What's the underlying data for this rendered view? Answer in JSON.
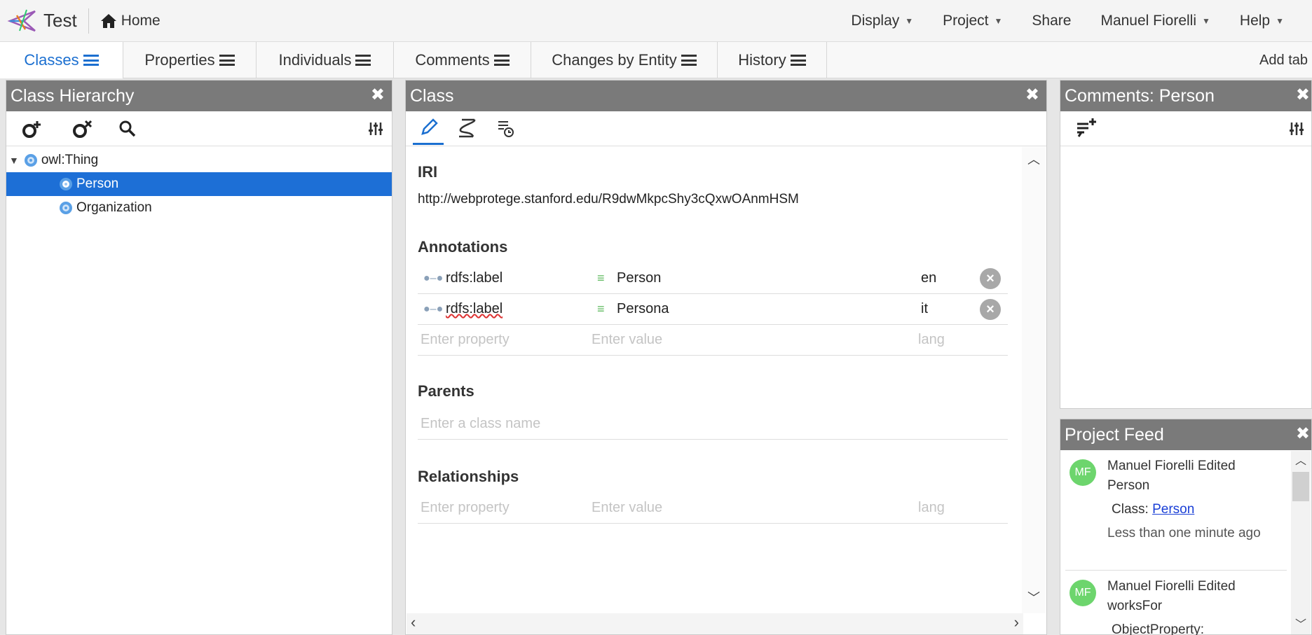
{
  "app": {
    "project_name": "Test",
    "home_label": "Home"
  },
  "topmenu": {
    "display": "Display",
    "project": "Project",
    "share": "Share",
    "user": "Manuel Fiorelli",
    "help": "Help"
  },
  "tabs": [
    {
      "label": "Classes",
      "active": true
    },
    {
      "label": "Properties"
    },
    {
      "label": "Individuals"
    },
    {
      "label": "Comments"
    },
    {
      "label": "Changes by Entity"
    },
    {
      "label": "History"
    }
  ],
  "add_tab": "Add tab",
  "class_hierarchy": {
    "title": "Class Hierarchy",
    "root": "owl:Thing",
    "children": [
      "Person",
      "Organization"
    ],
    "selected": "Person"
  },
  "class_panel": {
    "title": "Class",
    "iri_label": "IRI",
    "iri": "http://webprotege.stanford.edu/R9dwMkpcShy3cQxwOAnmHSM",
    "annotations_label": "Annotations",
    "annotations": [
      {
        "property": "rdfs:label",
        "value": "Person",
        "lang": "en"
      },
      {
        "property": "rdfs:label",
        "value": "Persona",
        "lang": "it"
      }
    ],
    "placeholders": {
      "property": "Enter property",
      "value": "Enter value",
      "lang": "lang",
      "class_name": "Enter a class name"
    },
    "parents_label": "Parents",
    "relationships_label": "Relationships"
  },
  "comments_panel": {
    "title": "Comments: Person"
  },
  "project_feed": {
    "title": "Project Feed",
    "items": [
      {
        "initials": "MF",
        "headline": "Manuel Fiorelli Edited",
        "entity": "Person",
        "kind_label": "Class:",
        "link": "Person",
        "time": "Less than one minute ago"
      },
      {
        "initials": "MF",
        "headline": "Manuel Fiorelli Edited",
        "entity": "worksFor",
        "kind_label": "ObjectProperty:"
      }
    ]
  },
  "colors": {
    "accent": "#1b6fd0",
    "header_gray": "#7a7a7a",
    "avatar_green": "#6dd56d"
  }
}
